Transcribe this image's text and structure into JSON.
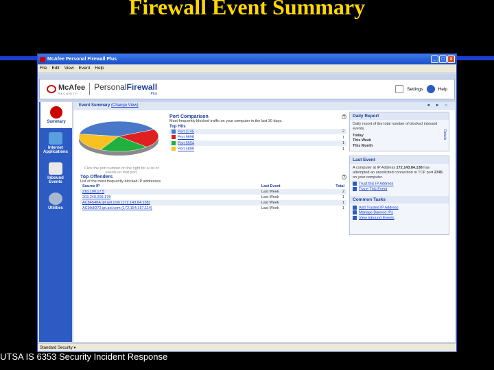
{
  "slide": {
    "title": "Firewall Event Summary",
    "footer": "UTSA IS 6353 Security Incident Response"
  },
  "window": {
    "title": "McAfee Personal Firewall Plus",
    "menu": [
      "File",
      "Edit",
      "View",
      "Event",
      "Help"
    ],
    "controls": [
      "_",
      "□",
      "×"
    ]
  },
  "header": {
    "brand": "McAfee",
    "brand_sub": "SECURITY",
    "product": "PersonalFirewall",
    "product_plain": "Personal",
    "product_bold": "Firewall",
    "product_sub": "Plus",
    "settings_label": "Settings",
    "help_label": "Help"
  },
  "sidebar": {
    "items": [
      {
        "label": "Summary",
        "icon": "summary-flame-icon"
      },
      {
        "label": "Internet Applications",
        "icon": "internet-apps-icon"
      },
      {
        "label": "Inbound Events",
        "icon": "inbound-events-icon"
      },
      {
        "label": "Utilities",
        "icon": "utilities-gears-icon"
      }
    ]
  },
  "crumb": {
    "title": "Event Summary",
    "change_view": "(Change View)",
    "nav": "◄ ► ⌂"
  },
  "port_comparison": {
    "title": "Port Comparison",
    "subtitle": "Most frequently blocked traffic on your computer in the last 30 days.",
    "top_hits_label": "Top Hits",
    "hint": "Click the port number on the right for a list of events on that port.",
    "rows": [
      {
        "port": "Port 2745",
        "count": "2",
        "color": "#4a78c8"
      },
      {
        "port": "Port 9898",
        "count": "1",
        "color": "#e02020"
      },
      {
        "port": "Port 5554",
        "count": "1",
        "color": "#20b040"
      },
      {
        "port": "Port 4899",
        "count": "1",
        "color": "#f8c020"
      }
    ]
  },
  "top_offenders": {
    "title": "Top Offenders",
    "subtitle": "List of the most frequently blocked IP addresses.",
    "columns": [
      "Source IP",
      "Last Event",
      "Total"
    ],
    "rows": [
      {
        "ip": "218.190.17.5",
        "last": "Last Week",
        "total": "2"
      },
      {
        "ip": "203.240.209.178",
        "last": "Last Week",
        "total": "1"
      },
      {
        "ip": "AC8F548A.ipt.aol.com (172.143.84.138)",
        "last": "Last Week",
        "total": "1"
      },
      {
        "ip": "AC9A9D72.ipt.aol.com (172.154.157.114)",
        "last": "Last Week",
        "total": "1"
      }
    ]
  },
  "daily_report": {
    "title": "Daily Report",
    "desc": "Daily report of the total number of blocked inbound events.",
    "today": "Today",
    "this_week": "This Week",
    "this_month": "This Month",
    "side_label": "Details"
  },
  "last_event": {
    "title": "Last Event",
    "text_prefix": "A computer at IP Address",
    "ip": "172.143.84.138",
    "text_mid": "has attempted an unsolicited connection to TCP port",
    "port": "2745",
    "text_end": "on your computer.",
    "links": [
      "Trust this IP Address",
      "Trace This Event"
    ]
  },
  "common_tasks": {
    "title": "Common Tasks",
    "links": [
      "Add Trusted IP Address",
      "Manage Banned IPs",
      "View Inbound Events"
    ]
  },
  "status": {
    "text": "Standard Security ▾"
  },
  "chart_data": {
    "type": "pie",
    "categories": [
      "Port 2745",
      "Port 9898",
      "Port 5554",
      "Port 4899"
    ],
    "values": [
      2,
      1,
      1,
      1
    ],
    "colors": [
      "#4a78c8",
      "#e02020",
      "#20b040",
      "#f8c020"
    ]
  }
}
